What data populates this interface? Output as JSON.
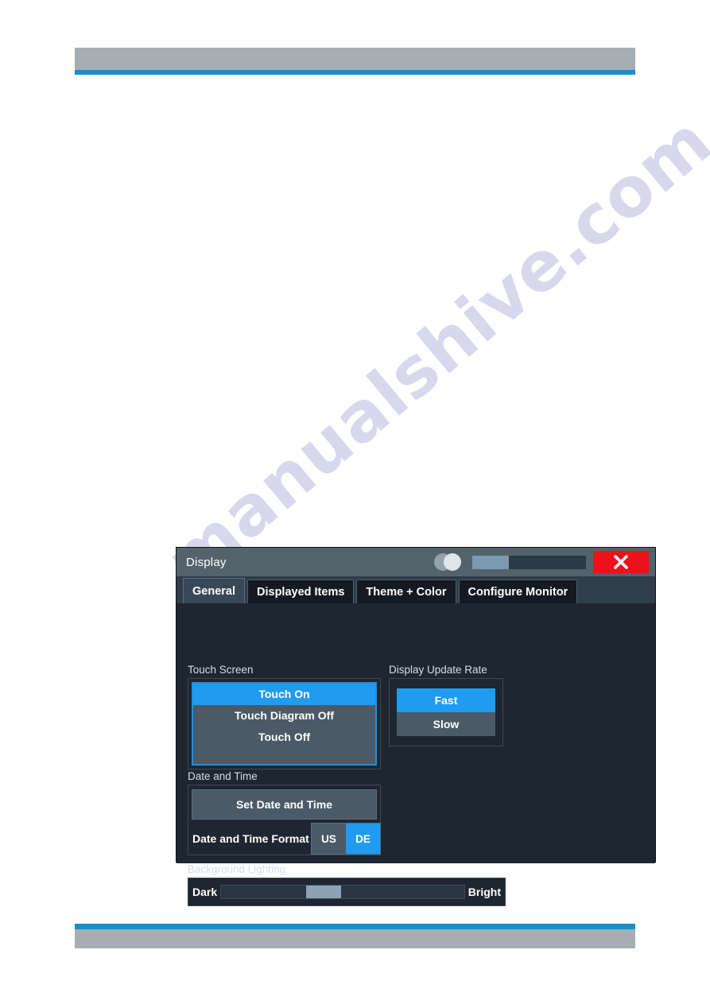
{
  "page": {
    "watermark": "manualshive.com",
    "header_color": "#a6aeb2",
    "rule_color": "#1b8ccd"
  },
  "dialog": {
    "title": "Display",
    "accent_color": "#1f9cf0",
    "close_color": "#ef1119",
    "titlebar": {
      "progress_percent": 32,
      "close_label": "Close"
    },
    "tabs": [
      {
        "label": "General",
        "active": true
      },
      {
        "label": "Displayed Items",
        "active": false
      },
      {
        "label": "Theme + Color",
        "active": false
      },
      {
        "label": "Configure Monitor",
        "active": false
      }
    ],
    "groups": {
      "touch_screen": {
        "label": "Touch Screen",
        "options": [
          {
            "label": "Touch On",
            "selected": true
          },
          {
            "label": "Touch Diagram Off",
            "selected": false
          },
          {
            "label": "Touch Off",
            "selected": false
          }
        ]
      },
      "display_update_rate": {
        "label": "Display Update Rate",
        "options": [
          {
            "label": "Fast",
            "selected": true
          },
          {
            "label": "Slow",
            "selected": false
          }
        ]
      },
      "date_and_time": {
        "label": "Date and Time",
        "set_button": "Set Date and Time",
        "format_label": "Date and Time Format",
        "format_options": [
          {
            "label": "US",
            "selected": false
          },
          {
            "label": "DE",
            "selected": true
          }
        ]
      },
      "background_lighting": {
        "label": "Background Lighting",
        "min_label": "Dark",
        "max_label": "Bright",
        "value_percent": 42
      }
    }
  }
}
